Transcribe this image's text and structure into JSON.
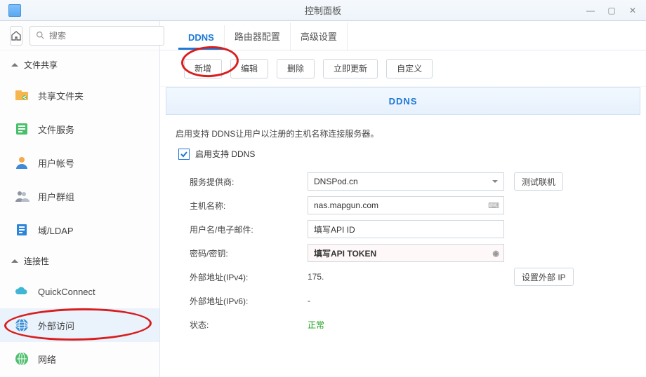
{
  "window": {
    "title": "控制面板"
  },
  "search": {
    "placeholder": "搜索"
  },
  "sections": {
    "fileShare": "文件共享",
    "connectivity": "连接性"
  },
  "sidebar": {
    "items": [
      {
        "label": "共享文件夹"
      },
      {
        "label": "文件服务"
      },
      {
        "label": "用户帐号"
      },
      {
        "label": "用户群组"
      },
      {
        "label": "域/LDAP"
      },
      {
        "label": "QuickConnect"
      },
      {
        "label": "外部访问"
      },
      {
        "label": "网络"
      }
    ]
  },
  "tabs": {
    "ddns": "DDNS",
    "router": "路由器配置",
    "advanced": "高级设置"
  },
  "toolbar": {
    "add": "新增",
    "edit": "编辑",
    "del": "删除",
    "refresh": "立即更新",
    "custom": "自定义"
  },
  "panel": {
    "header": "DDNS",
    "intro": "启用支持 DDNS让用户以注册的主机名称连接服务器。",
    "enable_label": "启用支持 DDNS",
    "provider_label": "服务提供商:",
    "provider_value": "DNSPod.cn",
    "test_btn": "测试联机",
    "host_label": "主机名称:",
    "host_value": "nas.mapgun.com",
    "user_label": "用户名/电子邮件:",
    "user_value": "填写API ID",
    "pass_label": "密码/密钥:",
    "pass_value": "填写API TOKEN",
    "ipv4_label": "外部地址(IPv4):",
    "ipv4_value": "175.",
    "setip_btn": "设置外部 IP",
    "ipv6_label": "外部地址(IPv6):",
    "ipv6_value": "-",
    "status_label": "状态:",
    "status_value": "正常"
  }
}
